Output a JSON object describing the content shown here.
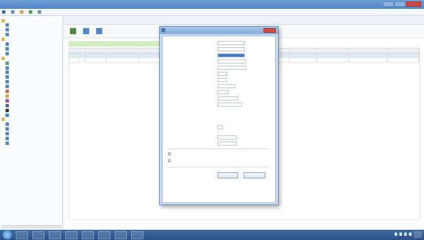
{
  "window": {
    "title": "",
    "accent": "#4f85c8"
  },
  "menubar": {
    "items": [
      {
        "label": "",
        "icon": "app-icon",
        "color": "#3b6fb6"
      },
      {
        "label": "",
        "icon": "file-icon",
        "color": "#6a8cc2"
      },
      {
        "label": "",
        "icon": "folder-icon",
        "color": "#d9a441"
      },
      {
        "label": "",
        "icon": "report-icon",
        "color": "#4aa05a"
      },
      {
        "label": "",
        "icon": "help-icon",
        "color": "#5b8fd0"
      }
    ]
  },
  "sidebar": {
    "items": [
      {
        "label": "",
        "icon": "folder-icon",
        "color": "#e0b44f"
      },
      {
        "label": "",
        "icon": "user-icon",
        "color": "#4e87cc"
      },
      {
        "label": "",
        "icon": "user-icon",
        "color": "#4e87cc"
      },
      {
        "label": "",
        "icon": "user-icon",
        "color": "#4e87cc"
      },
      {
        "label": "",
        "icon": "folder-icon",
        "color": "#e0b44f"
      },
      {
        "label": "",
        "icon": "user-icon",
        "color": "#4e87cc"
      },
      {
        "label": "",
        "icon": "user-icon",
        "color": "#4e87cc"
      },
      {
        "label": "",
        "icon": "user-icon",
        "color": "#4e87cc"
      },
      {
        "label": "",
        "icon": "folder-icon",
        "color": "#e0b44f"
      },
      {
        "label": "",
        "icon": "clock-icon",
        "color": "#5aa15a"
      },
      {
        "label": "",
        "icon": "door-icon",
        "color": "#4e87cc"
      },
      {
        "label": "",
        "icon": "door-icon",
        "color": "#4e87cc"
      },
      {
        "label": "",
        "icon": "door-icon",
        "color": "#4e87cc"
      },
      {
        "label": "",
        "icon": "door-icon",
        "color": "#4e87cc"
      },
      {
        "label": "",
        "icon": "door-icon",
        "color": "#4e87cc"
      },
      {
        "label": "",
        "icon": "person-icon",
        "color": "#c96b3a"
      },
      {
        "label": "",
        "icon": "shield-icon",
        "color": "#d8a63d"
      },
      {
        "label": "",
        "icon": "card-icon",
        "color": "#b04a8f"
      },
      {
        "label": "",
        "icon": "card-icon",
        "color": "#4a6fb0"
      },
      {
        "label": "",
        "icon": "card-icon",
        "color": "#3a3a3a"
      },
      {
        "label": "",
        "icon": "card-icon",
        "color": "#3a8fcf"
      },
      {
        "label": "",
        "icon": "folder-icon",
        "color": "#e0b44f"
      },
      {
        "label": "",
        "icon": "report-icon",
        "color": "#4e87cc"
      },
      {
        "label": "",
        "icon": "report-icon",
        "color": "#4e87cc"
      },
      {
        "label": "",
        "icon": "report-icon",
        "color": "#4e87cc"
      },
      {
        "label": "",
        "icon": "report-icon",
        "color": "#4e87cc"
      },
      {
        "label": "",
        "icon": "report-icon",
        "color": "#4e87cc"
      }
    ]
  },
  "main": {
    "tab_label": "",
    "toolbar": [
      {
        "label": "",
        "icon": "add-icon",
        "color": "#4a8a3c"
      },
      {
        "label": "",
        "icon": "search-icon",
        "color": "#4e87cc"
      },
      {
        "label": "",
        "icon": "edit-icon",
        "color": "#4e87cc"
      }
    ],
    "columns": [
      "",
      "",
      "",
      "",
      "",
      "",
      "",
      "",
      "",
      "",
      "",
      ""
    ],
    "rows": [
      [
        "",
        "",
        "",
        "",
        "",
        "",
        "",
        "",
        "",
        "",
        "",
        ""
      ],
      [
        "",
        "",
        "",
        "",
        "",
        "",
        "",
        "",
        "",
        "",
        "",
        ""
      ]
    ]
  },
  "dialog": {
    "title": "",
    "fields": [
      {
        "label": "",
        "value": "",
        "highlight": false
      },
      {
        "label": "",
        "value": "",
        "highlight": false
      },
      {
        "label": "",
        "value": "",
        "highlight": true
      },
      {
        "label": "",
        "value": "",
        "highlight": false
      },
      {
        "label": "",
        "value": "",
        "highlight": false
      },
      {
        "label": "",
        "value": "",
        "highlight": false,
        "extra": ""
      },
      {
        "label": "",
        "value": "",
        "highlight": false,
        "extra": ""
      },
      {
        "label": "",
        "value": "",
        "highlight": false
      },
      {
        "label": "",
        "value": "",
        "highlight": false,
        "extra": ""
      },
      {
        "label": "",
        "value": "",
        "highlight": false
      },
      {
        "label": "",
        "value": "",
        "highlight": false
      },
      {
        "label": "",
        "link": ""
      },
      {
        "label": "",
        "link": ""
      },
      {
        "label": "",
        "value": ""
      },
      {
        "label": "",
        "value": ""
      },
      {
        "label": "",
        "value": ""
      }
    ],
    "checkboxes": [
      {
        "label": "",
        "checked": false
      },
      {
        "label": "",
        "checked": false
      }
    ],
    "ok_label": "",
    "cancel_label": ""
  },
  "taskbar": {
    "items": [
      "ie-icon",
      "folder-icon",
      "media-icon",
      "network-icon",
      "app-icon",
      "paint-icon",
      "app-icon",
      "app-icon"
    ]
  }
}
